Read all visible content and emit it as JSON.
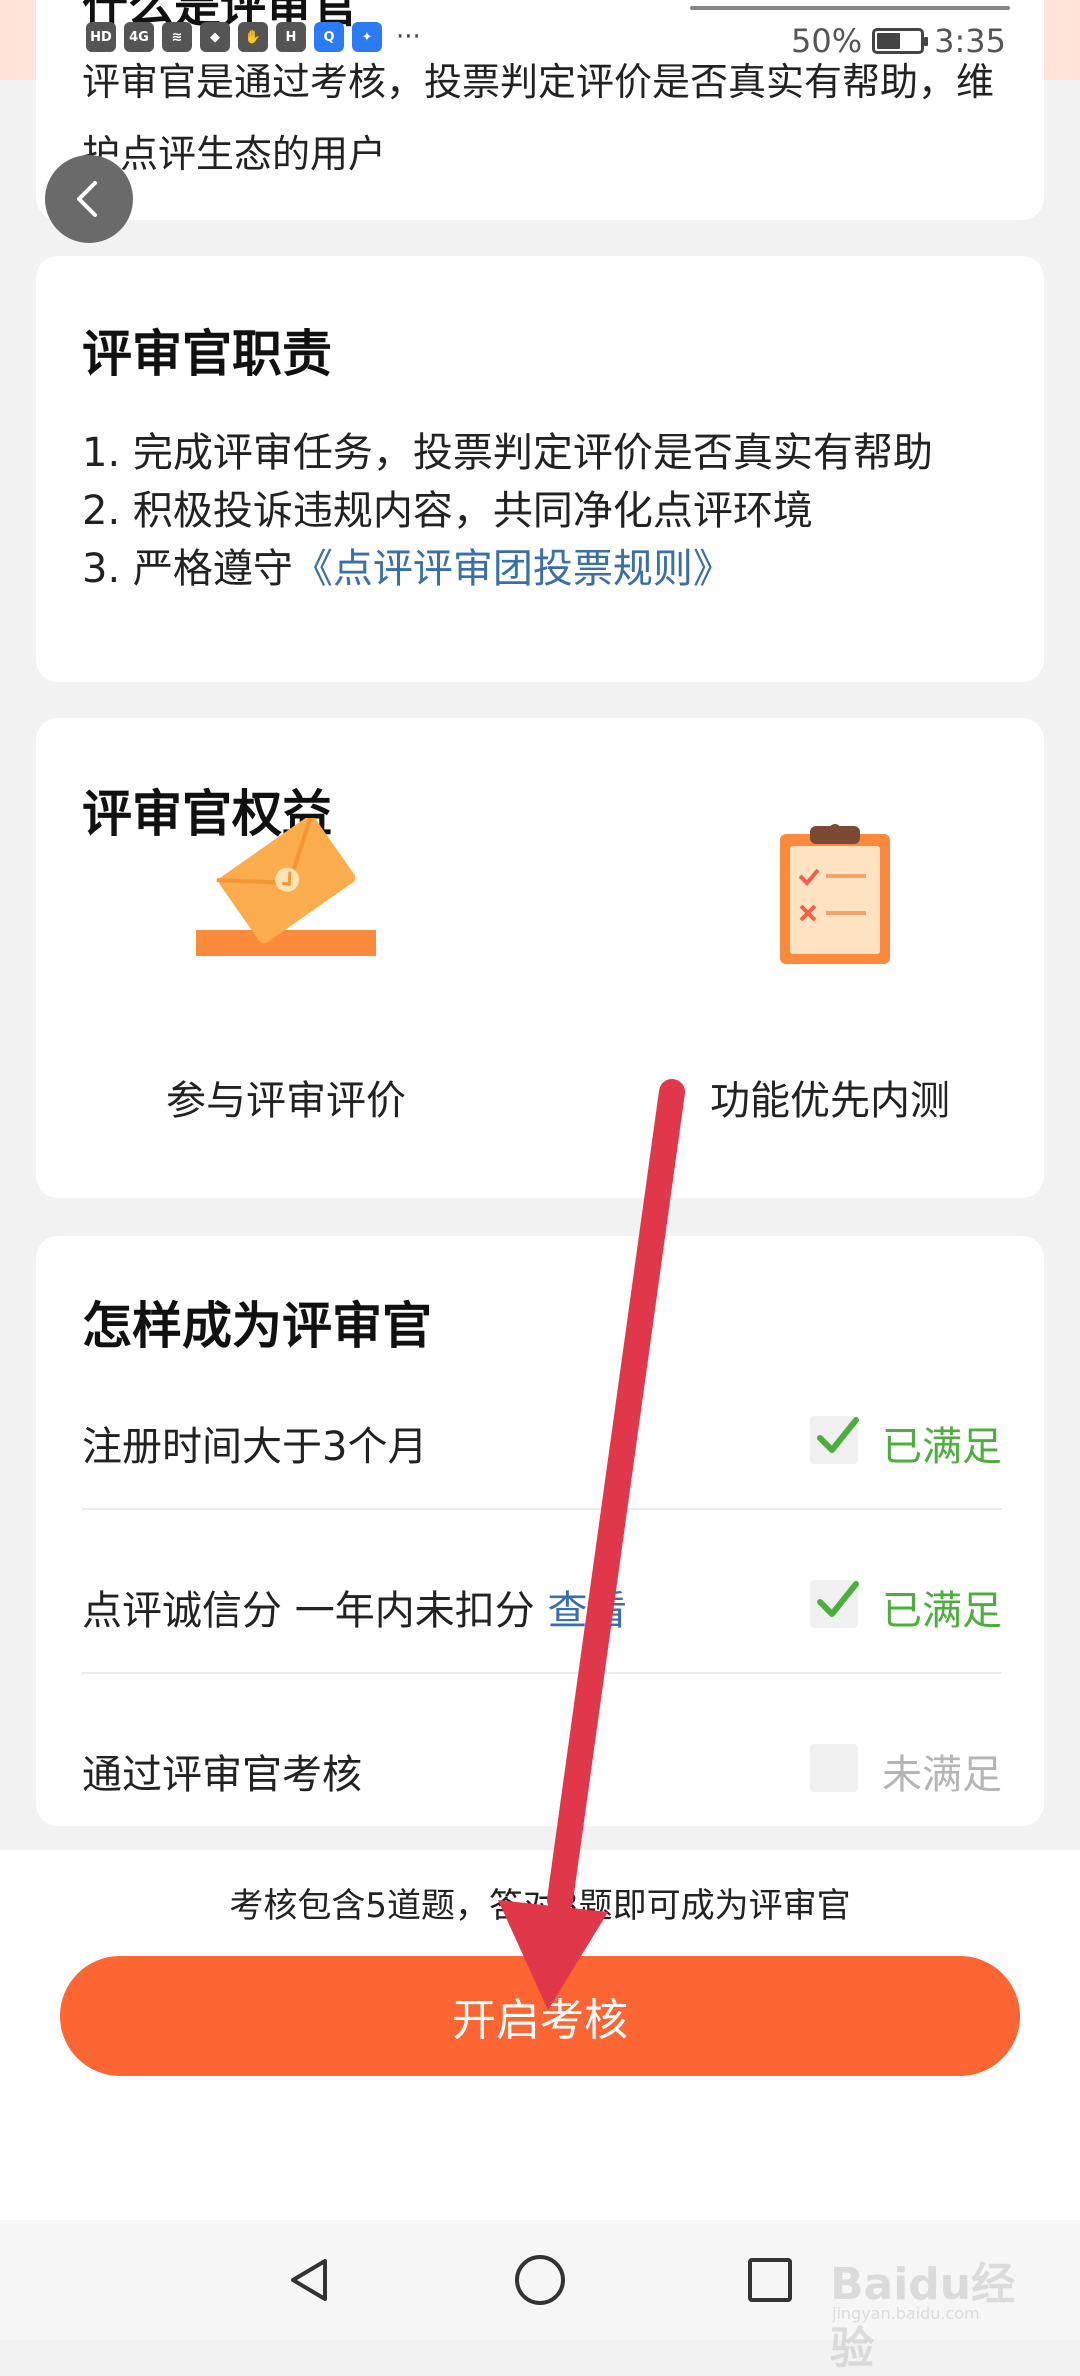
{
  "status_bar": {
    "left_icons": [
      "HD",
      "4G",
      "signal",
      "wifi",
      "shield",
      "hand",
      "HUAWEI",
      "Q",
      "bulb"
    ],
    "more": "···",
    "battery": "50%",
    "time": "3:35"
  },
  "intro": {
    "heading": "什么是评审官",
    "description": "评审官是通过考核，投票判定评价是否真实有帮助，维护点评生态的用户"
  },
  "duties": {
    "title": "评审官职责",
    "items": [
      {
        "text": "1. 完成评审任务，投票判定评价是否真实有帮助"
      },
      {
        "text": "2. 积极投诉违规内容，共同净化点评环境"
      },
      {
        "prefix": "3. 严格遵守",
        "link": "《点评评审团投票规则》"
      }
    ]
  },
  "benefits": {
    "title": "评审官权益",
    "items": [
      {
        "label": "参与评审评价",
        "icon": "envelope-vote-icon"
      },
      {
        "label": "功能优先内测",
        "icon": "clipboard-checklist-icon"
      }
    ]
  },
  "requirements": {
    "title": "怎样成为评审官",
    "items": [
      {
        "label": "注册时间大于3个月",
        "status": "已满足",
        "met": true
      },
      {
        "label": "点评诚信分 一年内未扣分",
        "link": "查看",
        "status": "已满足",
        "met": true
      },
      {
        "label": "通过评审官考核",
        "status": "未满足",
        "met": false
      }
    ]
  },
  "footer": {
    "hint": "考核包含5道题，答对3题即可成为评审官",
    "start_button": "开启考核"
  },
  "watermark": {
    "text": "Baidu经验",
    "sub": "jingyan.baidu.com"
  },
  "colors": {
    "accent": "#fd6533",
    "link": "#3a6fa8",
    "ok": "#4caf3d",
    "arrow": "#e0384a"
  }
}
